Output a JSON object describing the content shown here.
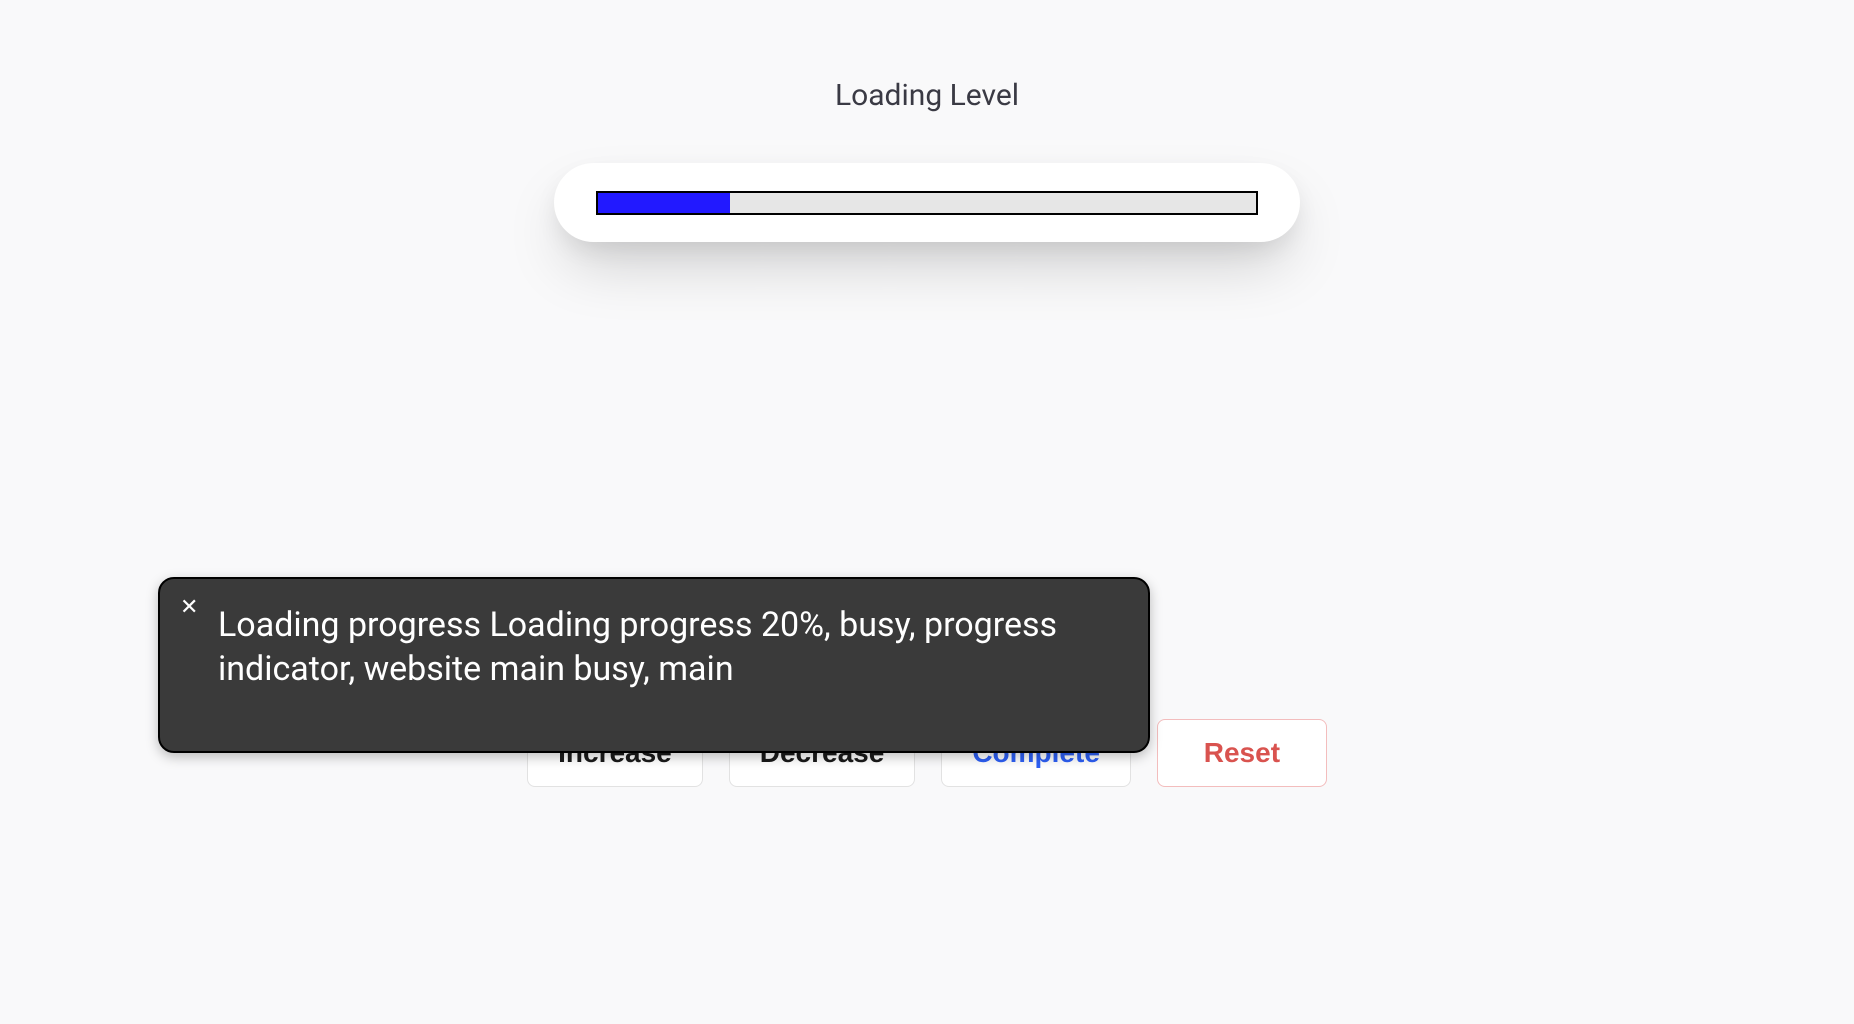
{
  "title": "Loading Level",
  "progress": {
    "percent": 20
  },
  "buttons": {
    "increase": "Increase",
    "decrease": "Decrease",
    "complete": "Complete",
    "reset": "Reset"
  },
  "tooltip": {
    "text": "Loading progress Loading progress 20%, busy, progress indicator, website main busy, main"
  }
}
